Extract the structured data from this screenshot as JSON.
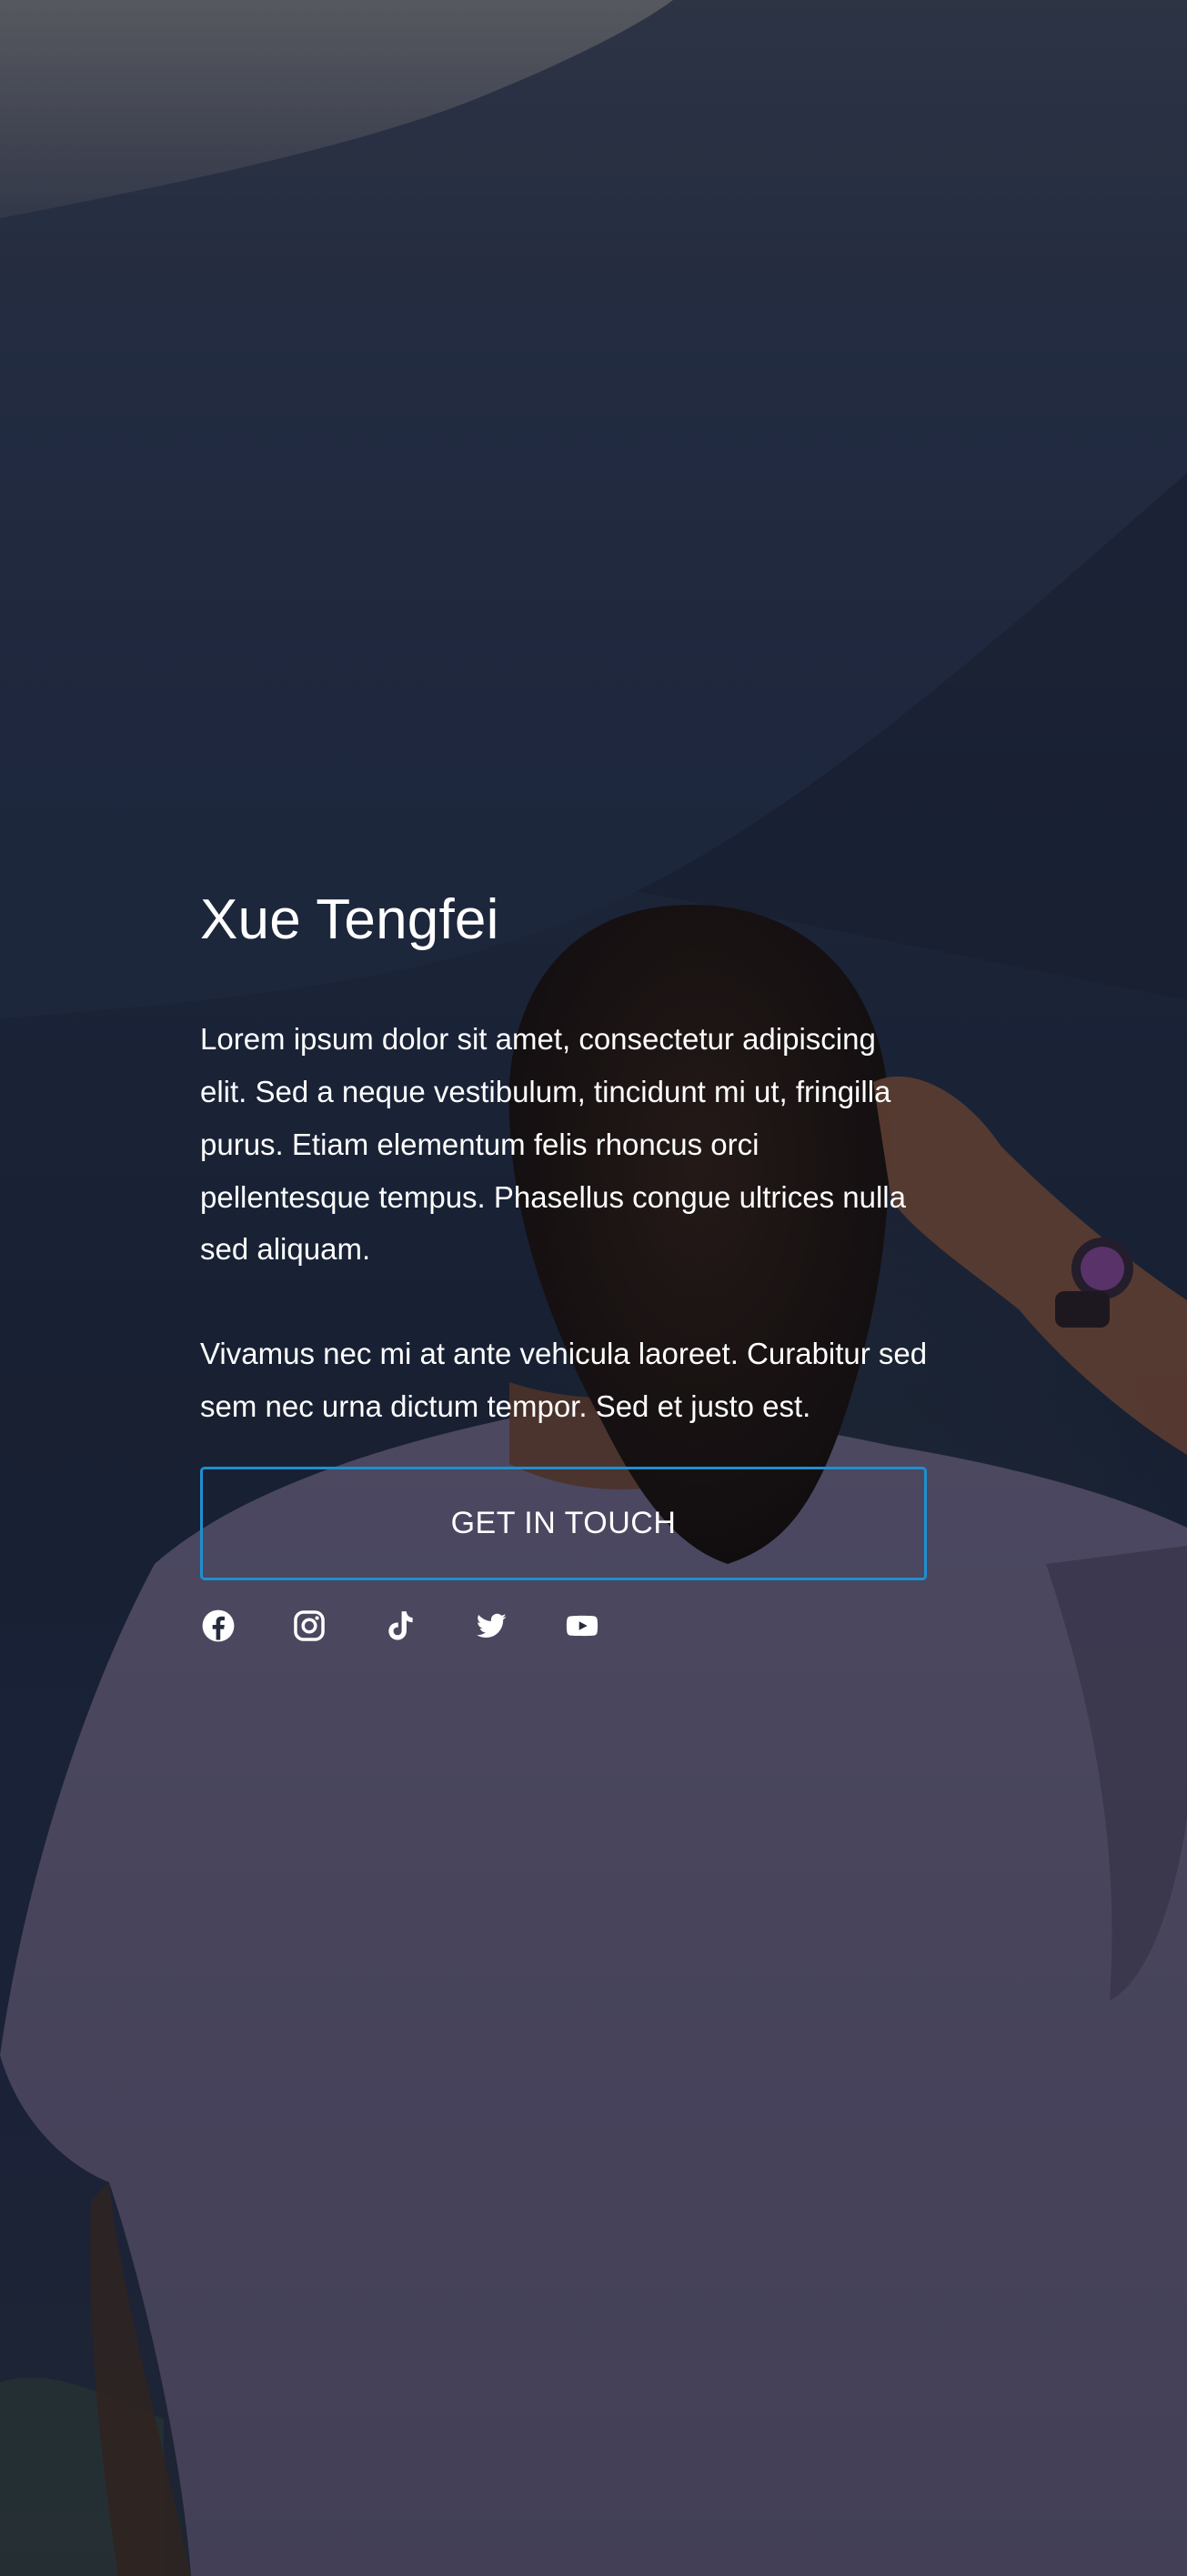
{
  "hero": {
    "title": "Xue Tengfei",
    "paragraph_1": "Lorem ipsum dolor sit amet, consectetur adipiscing elit. Sed a neque vestibulum, tincidunt mi ut, fringilla purus. Etiam elementum felis rhoncus orci pellentesque tempus. Phasellus congue ultrices nulla sed aliquam.",
    "paragraph_2": "Vivamus nec mi at ante vehicula laoreet. Curabitur sed sem nec urna dictum tempor. Sed et justo est.",
    "cta_label": "GET IN TOUCH"
  },
  "social": [
    "facebook-icon",
    "instagram-icon",
    "tiktok-icon",
    "twitter-icon",
    "youtube-icon"
  ],
  "colors": {
    "button_border": "#1e8fd0",
    "text": "#ffffff"
  }
}
